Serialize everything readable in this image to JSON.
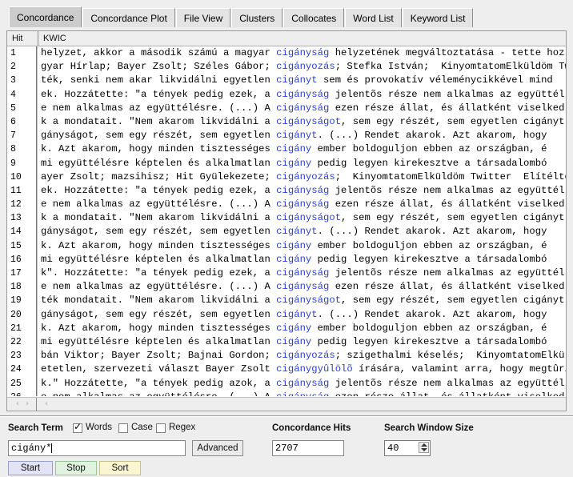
{
  "tabs": [
    {
      "label": "Concordance",
      "selected": true
    },
    {
      "label": "Concordance Plot",
      "selected": false
    },
    {
      "label": "File View",
      "selected": false
    },
    {
      "label": "Clusters",
      "selected": false
    },
    {
      "label": "Collocates",
      "selected": false
    },
    {
      "label": "Word List",
      "selected": false
    },
    {
      "label": "Keyword List",
      "selected": false
    }
  ],
  "table": {
    "columns": [
      "Hit",
      "KWIC"
    ],
    "rows": [
      {
        "hit": "1",
        "left": "helyzet, akkor a második számú a magyar ",
        "kw": "cigányság",
        "right": " helyzetének megváltoztatása - tette hoz"
      },
      {
        "hit": "2",
        "left": "gyar Hírlap; Bayer Zsolt; Széles Gábor; ",
        "kw": "cigányozás",
        "right": "; Stefka István;  KinyomtatomElküldöm Tw"
      },
      {
        "hit": "3",
        "left": "ték, senki nem akar likvidálni egyetlen ",
        "kw": "cigányt",
        "right": " sem és provokatív véleménycikkével mind"
      },
      {
        "hit": "4",
        "left": "ek. Hozzátette: \"a tények pedig ezek, a ",
        "kw": "cigányság",
        "right": " jelentõs része nem alkalmas az együttél"
      },
      {
        "hit": "5",
        "left": "e nem alkalmas az együttélésre. (...) A ",
        "kw": "cigányság",
        "right": " ezen része állat, és állatként viselked"
      },
      {
        "hit": "6",
        "left": "k a mondatait. \"Nem akarom likvidálni a ",
        "kw": "cigányságot",
        "right": ", sem egy részét, sem egyetlen cigányt."
      },
      {
        "hit": "7",
        "left": "gányságot, sem egy részét, sem egyetlen ",
        "kw": "cigányt",
        "right": ". (...) Rendet akarok. Azt akarom, hogy"
      },
      {
        "hit": "8",
        "left": "k. Azt akarom, hogy minden tisztességes ",
        "kw": "cigány",
        "right": " ember boldoguljon ebben az országban, é"
      },
      {
        "hit": "9",
        "left": "mi együttélésre képtelen és alkalmatlan ",
        "kw": "cigány",
        "right": " pedig legyen kirekesztve a társadalombó"
      },
      {
        "hit": "10",
        "left": "ayer Zsolt; mazsihisz; Hit Gyülekezete; ",
        "kw": "cigányozás",
        "right": ";  KinyomtatomElküldöm Twitter  Elítélte"
      },
      {
        "hit": "11",
        "left": "ek. Hozzátette: \"a tények pedig ezek, a ",
        "kw": "cigányság",
        "right": " jelentõs része nem alkalmas az együttél"
      },
      {
        "hit": "12",
        "left": "e nem alkalmas az együttélésre. (...) A ",
        "kw": "cigányság",
        "right": " ezen része állat, és állatként viselked"
      },
      {
        "hit": "13",
        "left": "k a mondatait. \"Nem akarom likvidálni a ",
        "kw": "cigányságot",
        "right": ", sem egy részét, sem egyetlen cigányt."
      },
      {
        "hit": "14",
        "left": "gányságot, sem egy részét, sem egyetlen ",
        "kw": "cigányt",
        "right": ". (...) Rendet akarok. Azt akarom, hogy"
      },
      {
        "hit": "15",
        "left": "k. Azt akarom, hogy minden tisztességes ",
        "kw": "cigány",
        "right": " ember boldoguljon ebben az országban, é"
      },
      {
        "hit": "16",
        "left": "mi együttélésre képtelen és alkalmatlan ",
        "kw": "cigány",
        "right": " pedig legyen kirekesztve a társadalombó"
      },
      {
        "hit": "17",
        "left": "k\". Hozzátette: \"a tények pedig ezek, a ",
        "kw": "cigányság",
        "right": " jelentõs része nem alkalmas az együttél"
      },
      {
        "hit": "18",
        "left": "e nem alkalmas az együttélésre. (...) A ",
        "kw": "cigányság",
        "right": " ezen része állat, és állatként viselked"
      },
      {
        "hit": "19",
        "left": "ték mondatait. \"Nem akarom likvidálni a ",
        "kw": "cigányságot",
        "right": ", sem egy részét, sem egyetlen cigányt."
      },
      {
        "hit": "20",
        "left": "gányságot, sem egy részét, sem egyetlen ",
        "kw": "cigányt",
        "right": ". (...) Rendet akarok. Azt akarom, hogy"
      },
      {
        "hit": "21",
        "left": "k. Azt akarom, hogy minden tisztességes ",
        "kw": "cigány",
        "right": " ember boldoguljon ebben az országban, é"
      },
      {
        "hit": "22",
        "left": "mi együttélésre képtelen és alkalmatlan ",
        "kw": "cigány",
        "right": " pedig legyen kirekesztve a társadalombó"
      },
      {
        "hit": "23",
        "left": "bán Viktor; Bayer Zsolt; Bajnai Gordon; ",
        "kw": "cigányozás",
        "right": "; szigethalmi késelés;  KinyomtatomElkül"
      },
      {
        "hit": "24",
        "left": "etetlen, szervezeti választ Bayer Zsolt ",
        "kw": "cigánygyûlölõ",
        "right": " írására, valamint arra, hogy megtûri-e"
      },
      {
        "hit": "25",
        "left": "k.\" Hozzátette, \"a tények pedig azok, a ",
        "kw": "cigányság",
        "right": " jelentõs része nem alkalmas az együttél"
      },
      {
        "hit": "26",
        "left": "e nem alkalmas az együttélésre. (...) A ",
        "kw": "cigányság",
        "right": " ezen része állat, és állatként viselked"
      }
    ]
  },
  "scroll": {
    "left_prev": "‹",
    "left_next": "›",
    "right_prev": "‹"
  },
  "search": {
    "label": "Search Term",
    "words_label": "Words",
    "words_checked": true,
    "case_label": "Case",
    "case_checked": false,
    "regex_label": "Regex",
    "regex_checked": false,
    "value": "cigány*",
    "placeholder": "",
    "advanced_label": "Advanced",
    "start_label": "Start",
    "stop_label": "Stop",
    "sort_label": "Sort"
  },
  "hits": {
    "label": "Concordance Hits",
    "value": "2707"
  },
  "window_size": {
    "label": "Search Window Size",
    "value": "40"
  },
  "colors": {
    "keyword": "#2b3ec7",
    "panel_bg": "#eeeeee",
    "selected_tab": "#cccccc"
  }
}
